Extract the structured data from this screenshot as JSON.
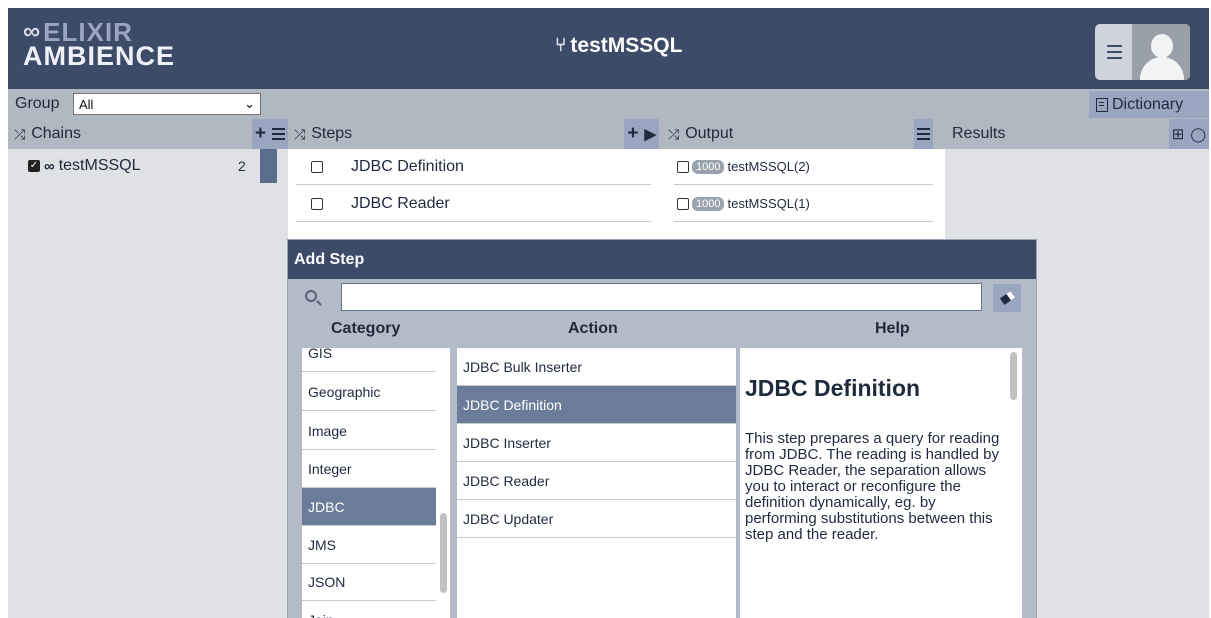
{
  "header": {
    "logo_line1": "ELIXIR",
    "logo_line2": "AMBIENCE",
    "title": "testMSSQL"
  },
  "toolbar": {
    "group_label": "Group",
    "group_value": "All",
    "dictionary_label": "Dictionary"
  },
  "panels": {
    "chains": "Chains",
    "steps": "Steps",
    "output": "Output",
    "results": "Results"
  },
  "chains": [
    {
      "name": "testMSSQL",
      "count": "2"
    }
  ],
  "steps": [
    {
      "label": "JDBC Definition"
    },
    {
      "label": "JDBC Reader"
    }
  ],
  "outputs": [
    {
      "badge": "1000",
      "label": "testMSSQL(2)"
    },
    {
      "badge": "1000",
      "label": "testMSSQL(1)"
    }
  ],
  "modal": {
    "title": "Add Step",
    "search_value": "",
    "headers": {
      "category": "Category",
      "action": "Action",
      "help": "Help"
    },
    "categories": [
      "GIS",
      "Geographic",
      "Image",
      "Integer",
      "JDBC",
      "JMS",
      "JSON",
      "Join"
    ],
    "selected_category": "JDBC",
    "actions": [
      "JDBC Bulk Inserter",
      "JDBC Definition",
      "JDBC Inserter",
      "JDBC Reader",
      "JDBC Updater"
    ],
    "selected_action": "JDBC Definition",
    "help_title": "JDBC Definition",
    "help_text": "This step prepares a query for reading from JDBC. The reading is handled by JDBC Reader, the separation allows you to interact or reconfigure the definition dynamically, eg. by performing substitutions between this step and the reader."
  },
  "colors": {
    "header_bg": "#3c4b68",
    "toolbar_bg": "#b2b8c2",
    "accent": "#98a6bf",
    "selection": "#6b7c9b"
  },
  "icons": [
    "infinity-logo-icon",
    "git-branch-icon",
    "menu-icon",
    "avatar-icon",
    "dictionary-icon",
    "shuffle-icon",
    "plus-icon",
    "play-icon",
    "table-icon",
    "comment-icon",
    "checkbox-icon",
    "link-icon",
    "search-icon",
    "eraser-icon"
  ]
}
